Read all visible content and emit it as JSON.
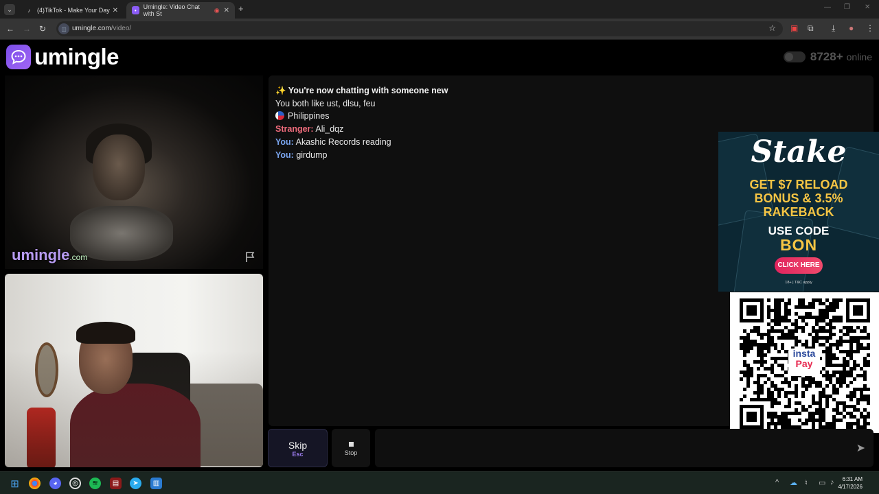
{
  "browser": {
    "tabs": [
      {
        "title": "(4)TikTok - Make Your Day",
        "close": "✕"
      },
      {
        "title": "Umingle: Video Chat with St",
        "close": "✕"
      }
    ],
    "new_tab": "+",
    "url_host": "umingle.com",
    "url_path": "/video/"
  },
  "site": {
    "logo_text": "umingle",
    "online_count": "8728+",
    "online_label": "online"
  },
  "remote_video": {
    "watermark_main": "umingle",
    "watermark_suffix": ".com"
  },
  "chat": {
    "system_line": "✨ You're now chatting with someone new",
    "interests_line": "You both like ust, dlsu, feu",
    "country": "Philippines",
    "messages": [
      {
        "speaker": "Stranger:",
        "text": "Ali_dqz"
      },
      {
        "speaker": "You:",
        "text": "Akashic Records reading"
      },
      {
        "speaker": "You:",
        "text": "girdump"
      }
    ]
  },
  "ad_stake": {
    "brand": "Stake",
    "headline_1": "GET $7 RELOAD",
    "headline_2": "BONUS & 3.5%",
    "headline_3": "RAKEBACK",
    "use_code": "USE CODE",
    "code": "BON",
    "cta": "CLICK HERE",
    "fine_print": "18+ | T&C apply"
  },
  "ad_qr": {
    "logo_line_1": "insta",
    "logo_line_2": "Pay"
  },
  "controls": {
    "skip_label": "Skip",
    "skip_key": "Esc",
    "stop_label": "Stop",
    "send_icon": "➤"
  },
  "taskbar": {
    "time": "6:31 AM",
    "date": "4/17/2026"
  },
  "colors": {
    "brand_purple": "#7b4ee8",
    "stranger_color": "#ee6b7b",
    "you_color": "#7aa5ef",
    "stake_gold": "#f6c544"
  }
}
